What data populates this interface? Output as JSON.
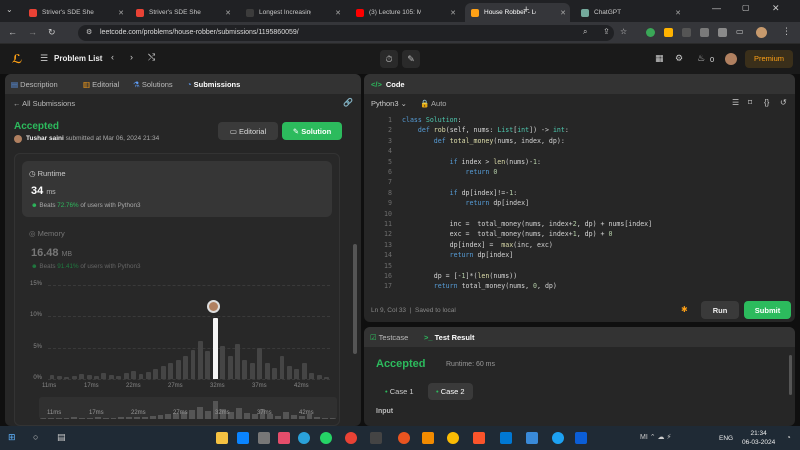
{
  "browser": {
    "tabs": [
      {
        "title": "Striver's SDE Sheet – Top C",
        "fav": "#e94235"
      },
      {
        "title": "Striver's SDE Sheet – Top C",
        "fav": "#e94235"
      },
      {
        "title": "Longest Increasing Subseq",
        "fav": "#3c3c3c"
      },
      {
        "title": "(3) Lecture 105: Maximum",
        "fav": "#ff0000"
      },
      {
        "title": "House Robber - LeetCode",
        "fav": "#ffa116"
      },
      {
        "title": "ChatGPT",
        "fav": "#74aa9c"
      }
    ],
    "url": "leetcode.com/problems/house-robber/submissions/1195860059/"
  },
  "nav": {
    "problem_list": "Problem List",
    "coins": "0",
    "premium": "Premium"
  },
  "left_tabs": {
    "description": "Description",
    "editorial": "Editorial",
    "solutions": "Solutions",
    "submissions": "Submissions"
  },
  "submission": {
    "back_label": "All Submissions",
    "status": "Accepted",
    "user": "Tushar saini",
    "submitted": "submitted at Mar 06, 2024 21:34",
    "editorial_btn": "Editorial",
    "solution_btn": "Solution",
    "runtime_label": "Runtime",
    "runtime_value": "34",
    "runtime_unit": "ms",
    "runtime_beats_pre": "Beats",
    "runtime_beats_pct": "72.76%",
    "runtime_beats_post": "of users with Python3",
    "memory_label": "Memory",
    "memory_value": "16.48",
    "memory_unit": "MB",
    "memory_beats_pre": "Beats",
    "memory_beats_pct": "91.41%",
    "memory_beats_post": "of users with Python3"
  },
  "chart_data": {
    "type": "bar",
    "yticks": [
      "15%",
      "10%",
      "5%",
      "0%"
    ],
    "ylim": [
      0,
      15
    ],
    "xticks": [
      "11ms",
      "17ms",
      "22ms",
      "27ms",
      "32ms",
      "37ms",
      "42ms"
    ],
    "values": [
      0.6,
      0.4,
      0.3,
      0.5,
      0.8,
      0.6,
      0.4,
      1.0,
      0.7,
      0.5,
      0.9,
      1.2,
      0.8,
      1.1,
      1.6,
      2.0,
      2.6,
      3.1,
      3.6,
      4.6,
      6.1,
      4.4,
      9.7,
      5.2,
      3.6,
      5.6,
      3.1,
      2.6,
      5.0,
      2.6,
      1.8,
      3.6,
      2.1,
      1.6,
      2.6,
      1.0,
      0.6,
      0.3
    ],
    "highlight_index": 22,
    "mini_xticks": [
      "11ms",
      "17ms",
      "22ms",
      "27ms",
      "32ms",
      "37ms",
      "42ms"
    ]
  },
  "code_panel": {
    "title": "Code",
    "language": "Python3",
    "mode": "Auto",
    "status": "Ln 9, Col 33",
    "saved": "Saved to local",
    "run": "Run",
    "submit": "Submit"
  },
  "result_panel": {
    "testcase_tab": "Testcase",
    "result_tab": "Test Result",
    "status": "Accepted",
    "runtime": "Runtime: 60 ms",
    "case1": "Case 1",
    "case2": "Case 2",
    "input_label": "Input"
  },
  "taskbar": {
    "time": "21:34",
    "date": "06-03-2024",
    "lang": "ENG"
  }
}
